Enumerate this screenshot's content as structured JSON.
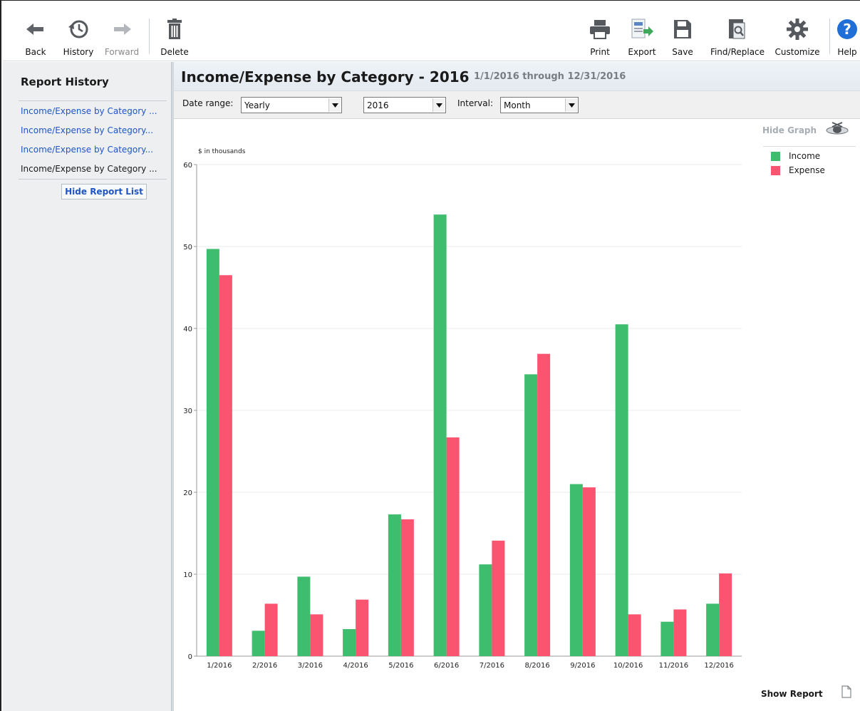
{
  "toolbar": {
    "back": "Back",
    "history": "History",
    "forward": "Forward",
    "delete": "Delete",
    "print": "Print",
    "export": "Export",
    "save": "Save",
    "find_replace": "Find/Replace",
    "customize": "Customize",
    "help": "Help"
  },
  "sidebar": {
    "title": "Report History",
    "items": [
      {
        "label": "Income/Expense by Category ..."
      },
      {
        "label": "Income/Expense by Category..."
      },
      {
        "label": "Income/Expense by Category..."
      },
      {
        "label": "Income/Expense by Category ..."
      }
    ],
    "hide_list": "Hide Report List"
  },
  "report": {
    "title": "Income/Expense by Category - 2016",
    "range": "1/1/2016 through 12/31/2016"
  },
  "filters": {
    "date_range_label": "Date range:",
    "date_range_value": "Yearly",
    "year_value": "2016",
    "interval_label": "Interval:",
    "interval_value": "Month"
  },
  "graph_controls": {
    "hide_graph": "Hide Graph",
    "show_report": "Show Report"
  },
  "colors": {
    "income": "#3dbd6d",
    "expense": "#fb5470",
    "link": "#1f56c4"
  },
  "chart_data": {
    "type": "bar",
    "ylabel": "$ in thousands",
    "ylim": [
      0,
      60
    ],
    "yticks": [
      0,
      10,
      20,
      30,
      40,
      50,
      60
    ],
    "categories": [
      "1/2016",
      "2/2016",
      "3/2016",
      "4/2016",
      "5/2016",
      "6/2016",
      "7/2016",
      "8/2016",
      "9/2016",
      "10/2016",
      "11/2016",
      "12/2016"
    ],
    "series": [
      {
        "name": "Income",
        "color": "#3dbd6d",
        "values": [
          49.7,
          3.1,
          9.7,
          3.3,
          17.3,
          53.9,
          11.2,
          34.4,
          21.0,
          40.5,
          4.2,
          6.4
        ]
      },
      {
        "name": "Expense",
        "color": "#fb5470",
        "values": [
          46.5,
          6.4,
          5.1,
          6.9,
          16.7,
          26.7,
          14.1,
          36.9,
          20.6,
          5.1,
          5.7,
          10.1
        ]
      }
    ],
    "grid": true,
    "legend": "top-right"
  }
}
